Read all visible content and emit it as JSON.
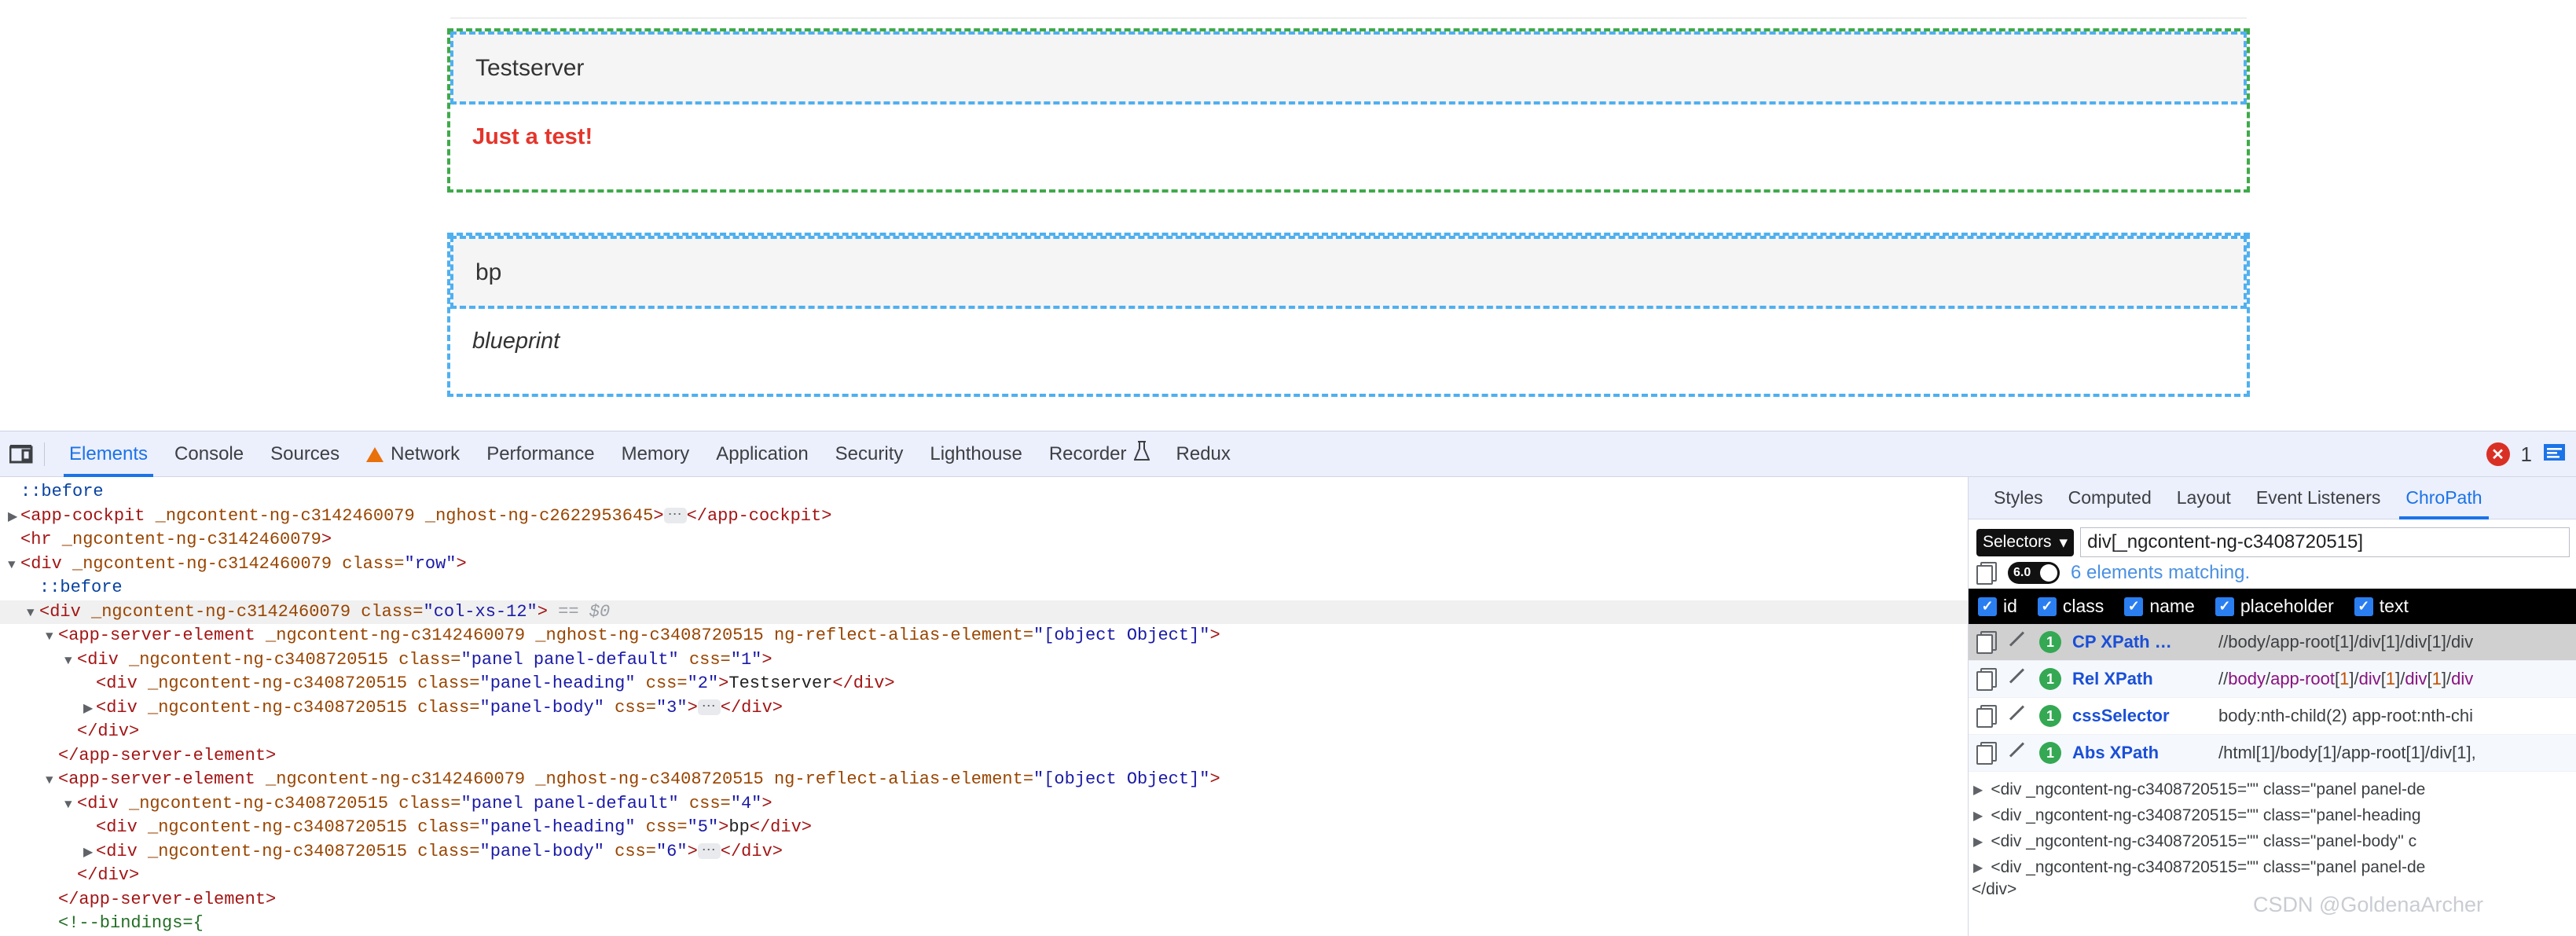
{
  "app": {
    "panels": [
      {
        "heading": "Testserver",
        "body": "Just a test!",
        "body_style": "red-bold",
        "outline": "green-outer-blue-inner"
      },
      {
        "heading": "bp",
        "body": "blueprint",
        "body_style": "italic",
        "outline": "blue"
      }
    ]
  },
  "devtools": {
    "dock_icon": "dock-panel-icon",
    "tabs": [
      {
        "label": "Elements",
        "active": true,
        "icon": ""
      },
      {
        "label": "Console",
        "active": false,
        "icon": ""
      },
      {
        "label": "Sources",
        "active": false,
        "icon": ""
      },
      {
        "label": "Network",
        "active": false,
        "icon": "warning-triangle-icon"
      },
      {
        "label": "Performance",
        "active": false,
        "icon": ""
      },
      {
        "label": "Memory",
        "active": false,
        "icon": ""
      },
      {
        "label": "Application",
        "active": false,
        "icon": ""
      },
      {
        "label": "Security",
        "active": false,
        "icon": ""
      },
      {
        "label": "Lighthouse",
        "active": false,
        "icon": ""
      },
      {
        "label": "Recorder",
        "active": false,
        "icon": "flask-icon"
      },
      {
        "label": "Redux",
        "active": false,
        "icon": ""
      }
    ],
    "status": {
      "error_icon": "error-circle-icon",
      "error_count": "1",
      "settings_icon": "console-drawer-icon"
    },
    "dom_lines": [
      {
        "indent": 0,
        "arrow": "none",
        "parts": [
          {
            "t": "pseudo",
            "v": "::before"
          }
        ]
      },
      {
        "indent": 0,
        "arrow": "closed",
        "parts": [
          {
            "t": "tag",
            "v": "<app-cockpit"
          },
          {
            "t": "attr",
            "v": " _ngcontent-ng-c3142460079"
          },
          {
            "t": "attr",
            "v": " _nghost-ng-c2622953645"
          },
          {
            "t": "tag",
            "v": ">"
          },
          {
            "t": "ellipsis",
            "v": "…"
          },
          {
            "t": "tag",
            "v": "</app-cockpit>"
          }
        ]
      },
      {
        "indent": 0,
        "arrow": "none",
        "parts": [
          {
            "t": "tag",
            "v": "<hr"
          },
          {
            "t": "attr",
            "v": " _ngcontent-ng-c3142460079"
          },
          {
            "t": "tag",
            "v": ">"
          }
        ]
      },
      {
        "indent": 0,
        "arrow": "open",
        "parts": [
          {
            "t": "tag",
            "v": "<div"
          },
          {
            "t": "attr",
            "v": " _ngcontent-ng-c3142460079"
          },
          {
            "t": "attr",
            "v": " class="
          },
          {
            "t": "val",
            "v": "\"row\""
          },
          {
            "t": "tag",
            "v": ">"
          }
        ]
      },
      {
        "indent": 1,
        "arrow": "none",
        "parts": [
          {
            "t": "pseudo",
            "v": "::before"
          }
        ]
      },
      {
        "indent": 1,
        "arrow": "open",
        "selected": true,
        "parts": [
          {
            "t": "tag",
            "v": "<div"
          },
          {
            "t": "attr",
            "v": " _ngcontent-ng-c3142460079"
          },
          {
            "t": "attr",
            "v": " class="
          },
          {
            "t": "val",
            "v": "\"col-xs-12\""
          },
          {
            "t": "tag",
            "v": ">"
          },
          {
            "t": "dollar",
            "v": " == $0"
          }
        ]
      },
      {
        "indent": 2,
        "arrow": "open",
        "parts": [
          {
            "t": "tag",
            "v": "<app-server-element"
          },
          {
            "t": "attr",
            "v": " _ngcontent-ng-c3142460079"
          },
          {
            "t": "attr",
            "v": " _nghost-ng-c3408720515"
          },
          {
            "t": "attr",
            "v": " ng-reflect-alias-element="
          },
          {
            "t": "val",
            "v": "\"[object Object]\""
          },
          {
            "t": "tag",
            "v": ">"
          }
        ]
      },
      {
        "indent": 3,
        "arrow": "open",
        "parts": [
          {
            "t": "tag",
            "v": "<div"
          },
          {
            "t": "attr",
            "v": " _ngcontent-ng-c3408720515"
          },
          {
            "t": "attr",
            "v": " class="
          },
          {
            "t": "val",
            "v": "\"panel panel-default\""
          },
          {
            "t": "attr",
            "v": " css="
          },
          {
            "t": "val",
            "v": "\"1\""
          },
          {
            "t": "tag",
            "v": ">"
          }
        ]
      },
      {
        "indent": 4,
        "arrow": "none",
        "parts": [
          {
            "t": "tag",
            "v": "<div"
          },
          {
            "t": "attr",
            "v": " _ngcontent-ng-c3408720515"
          },
          {
            "t": "attr",
            "v": " class="
          },
          {
            "t": "val",
            "v": "\"panel-heading\""
          },
          {
            "t": "attr",
            "v": " css="
          },
          {
            "t": "val",
            "v": "\"2\""
          },
          {
            "t": "tag",
            "v": ">"
          },
          {
            "t": "txt",
            "v": "Testserver"
          },
          {
            "t": "tag",
            "v": "</div>"
          }
        ]
      },
      {
        "indent": 4,
        "arrow": "closed",
        "parts": [
          {
            "t": "tag",
            "v": "<div"
          },
          {
            "t": "attr",
            "v": " _ngcontent-ng-c3408720515"
          },
          {
            "t": "attr",
            "v": " class="
          },
          {
            "t": "val",
            "v": "\"panel-body\""
          },
          {
            "t": "attr",
            "v": " css="
          },
          {
            "t": "val",
            "v": "\"3\""
          },
          {
            "t": "tag",
            "v": ">"
          },
          {
            "t": "ellipsis",
            "v": "…"
          },
          {
            "t": "tag",
            "v": "</div>"
          }
        ]
      },
      {
        "indent": 3,
        "arrow": "none",
        "parts": [
          {
            "t": "tag",
            "v": "</div>"
          }
        ]
      },
      {
        "indent": 2,
        "arrow": "none",
        "parts": [
          {
            "t": "tag",
            "v": "</app-server-element>"
          }
        ]
      },
      {
        "indent": 2,
        "arrow": "open",
        "parts": [
          {
            "t": "tag",
            "v": "<app-server-element"
          },
          {
            "t": "attr",
            "v": " _ngcontent-ng-c3142460079"
          },
          {
            "t": "attr",
            "v": " _nghost-ng-c3408720515"
          },
          {
            "t": "attr",
            "v": " ng-reflect-alias-element="
          },
          {
            "t": "val",
            "v": "\"[object Object]\""
          },
          {
            "t": "tag",
            "v": ">"
          }
        ]
      },
      {
        "indent": 3,
        "arrow": "open",
        "parts": [
          {
            "t": "tag",
            "v": "<div"
          },
          {
            "t": "attr",
            "v": " _ngcontent-ng-c3408720515"
          },
          {
            "t": "attr",
            "v": " class="
          },
          {
            "t": "val",
            "v": "\"panel panel-default\""
          },
          {
            "t": "attr",
            "v": " css="
          },
          {
            "t": "val",
            "v": "\"4\""
          },
          {
            "t": "tag",
            "v": ">"
          }
        ]
      },
      {
        "indent": 4,
        "arrow": "none",
        "parts": [
          {
            "t": "tag",
            "v": "<div"
          },
          {
            "t": "attr",
            "v": " _ngcontent-ng-c3408720515"
          },
          {
            "t": "attr",
            "v": " class="
          },
          {
            "t": "val",
            "v": "\"panel-heading\""
          },
          {
            "t": "attr",
            "v": " css="
          },
          {
            "t": "val",
            "v": "\"5\""
          },
          {
            "t": "tag",
            "v": ">"
          },
          {
            "t": "txt",
            "v": "bp"
          },
          {
            "t": "tag",
            "v": "</div>"
          }
        ]
      },
      {
        "indent": 4,
        "arrow": "closed",
        "parts": [
          {
            "t": "tag",
            "v": "<div"
          },
          {
            "t": "attr",
            "v": " _ngcontent-ng-c3408720515"
          },
          {
            "t": "attr",
            "v": " class="
          },
          {
            "t": "val",
            "v": "\"panel-body\""
          },
          {
            "t": "attr",
            "v": " css="
          },
          {
            "t": "val",
            "v": "\"6\""
          },
          {
            "t": "tag",
            "v": ">"
          },
          {
            "t": "ellipsis",
            "v": "…"
          },
          {
            "t": "tag",
            "v": "</div>"
          }
        ]
      },
      {
        "indent": 3,
        "arrow": "none",
        "parts": [
          {
            "t": "tag",
            "v": "</div>"
          }
        ]
      },
      {
        "indent": 2,
        "arrow": "none",
        "parts": [
          {
            "t": "tag",
            "v": "</app-server-element>"
          }
        ]
      },
      {
        "indent": 2,
        "arrow": "none",
        "parts": [
          {
            "t": "comment",
            "v": "<!--bindings={"
          }
        ]
      }
    ],
    "sidebar": {
      "tabs": [
        {
          "label": "Styles",
          "active": false
        },
        {
          "label": "Computed",
          "active": false
        },
        {
          "label": "Layout",
          "active": false
        },
        {
          "label": "Event Listeners",
          "active": false
        },
        {
          "label": "ChroPath",
          "active": true
        }
      ],
      "chropath": {
        "select_label": "Selectors",
        "select_icon": "chevron-down-icon",
        "input_value": "div[_ngcontent-ng-c3408720515]",
        "copy_icon": "copy-icon",
        "toggle_value": "6.0",
        "match_text": "6 elements matching.",
        "filters": [
          {
            "label": "id",
            "checked": true
          },
          {
            "label": "class",
            "checked": true
          },
          {
            "label": "name",
            "checked": true
          },
          {
            "label": "placeholder",
            "checked": true
          },
          {
            "label": "text",
            "checked": true
          }
        ],
        "rows": [
          {
            "label": "CP XPath …",
            "value": "//body/app-root[1]/div[1]/div[1]/div",
            "count": "1",
            "highlight": true
          },
          {
            "label": "Rel XPath",
            "value": "//body/app-root[1]/div[1]/div[1]/div",
            "count": "1",
            "colored": true
          },
          {
            "label": "cssSelector",
            "value": "body:nth-child(2) app-root:nth-chi",
            "count": "1"
          },
          {
            "label": "Abs XPath",
            "value": "/html[1]/body[1]/app-root[1]/div[1],",
            "count": "1"
          }
        ],
        "matches": [
          {
            "arrow": "closed",
            "text": "<div _ngcontent-ng-c3408720515=\"\" class=\"panel panel-de"
          },
          {
            "arrow": "closed",
            "text": "<div _ngcontent-ng-c3408720515=\"\" class=\"panel-heading"
          },
          {
            "arrow": "closed",
            "text": "<div _ngcontent-ng-c3408720515=\"\" class=\"panel-body\" c"
          },
          {
            "arrow": "closed",
            "text": "<div _ngcontent-ng-c3408720515=\"\" class=\"panel panel-de"
          }
        ],
        "closing_tag": "</div>"
      }
    }
  },
  "watermark": "CSDN @GoldenaArcher"
}
